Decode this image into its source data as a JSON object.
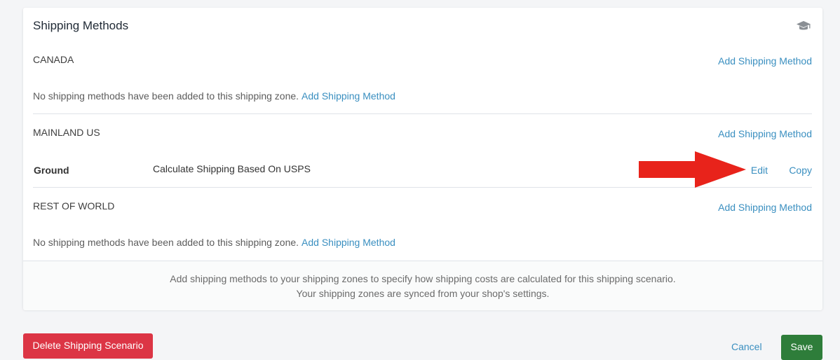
{
  "card": {
    "title": "Shipping Methods",
    "help_icon": "graduation-cap-icon"
  },
  "zones": [
    {
      "name": "CANADA",
      "add_label": "Add Shipping Method",
      "empty_text": "No shipping methods have been added to this shipping zone.",
      "empty_link": "Add Shipping Method"
    },
    {
      "name": "MAINLAND US",
      "add_label": "Add Shipping Method",
      "methods": [
        {
          "name": "Ground",
          "description": "Calculate Shipping Based On USPS",
          "edit_label": "Edit",
          "copy_label": "Copy"
        }
      ]
    },
    {
      "name": "REST OF WORLD",
      "add_label": "Add Shipping Method",
      "empty_text": "No shipping methods have been added to this shipping zone.",
      "empty_link": "Add Shipping Method"
    }
  ],
  "footer": {
    "line1": "Add shipping methods to your shipping zones to specify how shipping costs are calculated for this shipping scenario.",
    "line2": "Your shipping zones are synced from your shop's settings."
  },
  "actions": {
    "delete_label": "Delete Shipping Scenario",
    "cancel_label": "Cancel",
    "save_label": "Save"
  },
  "annotation": {
    "arrow_color": "#e8231b",
    "arrow_icon": "red-arrow-pointer-icon"
  },
  "colors": {
    "link": "#3a8fc0",
    "danger": "#dc3545",
    "success": "#2e7d3a"
  }
}
